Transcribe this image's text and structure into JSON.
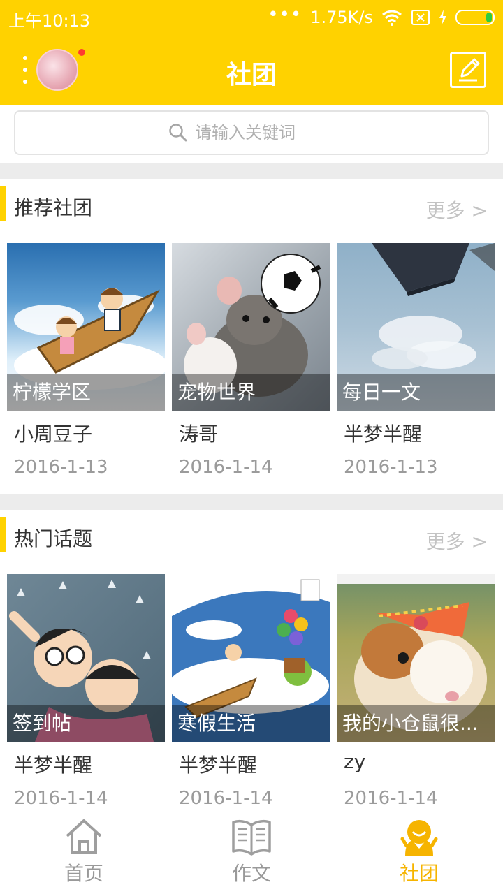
{
  "status_bar": {
    "time": "上午10:13",
    "network_speed": "1.75K/s"
  },
  "header": {
    "title": "社团",
    "has_notification_dot": true
  },
  "search": {
    "placeholder": "请输入关键词"
  },
  "sections": [
    {
      "title": "推荐社团",
      "more_label": "更多 >",
      "items": [
        {
          "name": "柠檬学区",
          "author": "小周豆子",
          "date": "2016-1-13",
          "image": "cartoon-kids-boat"
        },
        {
          "name": "宠物世界",
          "author": "涛哥",
          "date": "2016-1-14",
          "image": "rats-with-soccer-ball"
        },
        {
          "name": "每日一文",
          "author": "半梦半醒",
          "date": "2016-1-13",
          "image": "sky-clouds-building"
        }
      ]
    },
    {
      "title": "热门话题",
      "more_label": "更多 >",
      "items": [
        {
          "name": "签到帖",
          "author": "半梦半醒",
          "date": "2016-1-14",
          "image": "astro-boy-mug"
        },
        {
          "name": "寒假生活",
          "author": "半梦半醒",
          "date": "2016-1-14",
          "image": "cartoon-balloons-boat"
        },
        {
          "name": "我的小仓鼠很...",
          "author": "zy",
          "date": "2016-1-14",
          "image": "guinea-pig-bow"
        }
      ]
    }
  ],
  "bottom_nav": [
    {
      "label": "首页",
      "icon": "home-icon",
      "active": false
    },
    {
      "label": "作文",
      "icon": "book-icon",
      "active": false
    },
    {
      "label": "社团",
      "icon": "community-icon",
      "active": true
    }
  ],
  "colors": {
    "accent": "#ffd200",
    "active_tab": "#f6b400",
    "muted_text": "#9b9b9b"
  }
}
